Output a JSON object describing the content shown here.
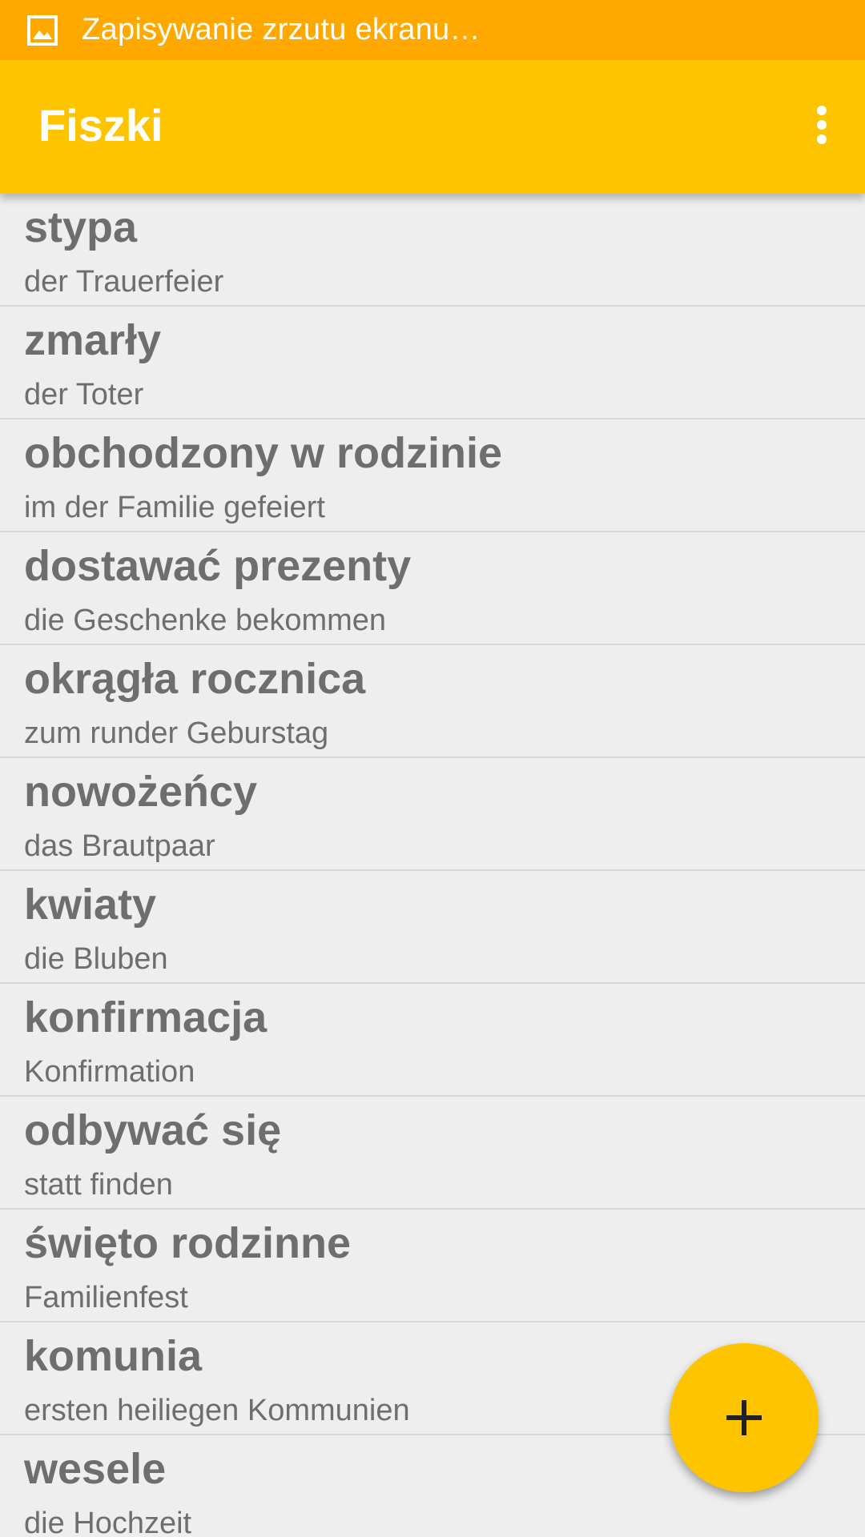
{
  "status_bar": {
    "icon": "image-icon",
    "text": "Zapisywanie zrzutu ekranu…",
    "background": "#ffa800"
  },
  "app_bar": {
    "title": "Fiszki",
    "overflow_icon": "more-vert-icon",
    "background": "#ffc400"
  },
  "flashcards": [
    {
      "word": "stypa",
      "translation": "der Trauerfeier"
    },
    {
      "word": "zmarły",
      "translation": "der Toter"
    },
    {
      "word": "obchodzony w rodzinie",
      "translation": "im der Familie gefeiert"
    },
    {
      "word": "dostawać prezenty",
      "translation": "die Geschenke bekommen"
    },
    {
      "word": "okrągła rocznica",
      "translation": "zum runder Geburstag"
    },
    {
      "word": "nowożeńcy",
      "translation": "das Brautpaar"
    },
    {
      "word": "kwiaty",
      "translation": "die Bluben"
    },
    {
      "word": "konfirmacja",
      "translation": "Konfirmation"
    },
    {
      "word": "odbywać się",
      "translation": "statt finden"
    },
    {
      "word": "święto rodzinne",
      "translation": "Familienfest"
    },
    {
      "word": "komunia",
      "translation": "ersten heiliegen Kommunien"
    },
    {
      "word": "wesele",
      "translation": "die Hochzeit"
    }
  ],
  "fab": {
    "icon": "plus-icon",
    "color": "#ffc400"
  }
}
